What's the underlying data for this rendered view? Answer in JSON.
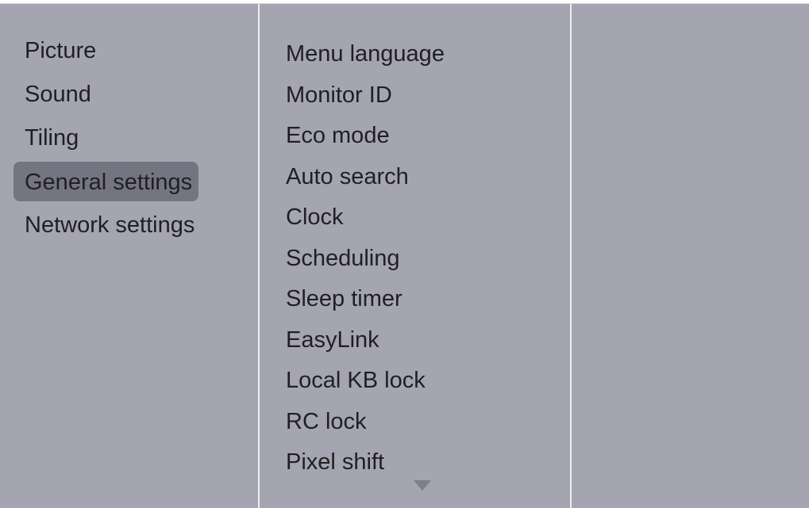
{
  "main_menu": {
    "items": [
      {
        "label": "Picture"
      },
      {
        "label": "Sound"
      },
      {
        "label": "Tiling"
      },
      {
        "label": "General settings",
        "selected": true
      },
      {
        "label": "Network settings"
      }
    ]
  },
  "submenu": {
    "items": [
      {
        "label": "Menu language"
      },
      {
        "label": "Monitor ID"
      },
      {
        "label": "Eco mode"
      },
      {
        "label": "Auto search"
      },
      {
        "label": "Clock"
      },
      {
        "label": "Scheduling"
      },
      {
        "label": "Sleep timer"
      },
      {
        "label": "EasyLink"
      },
      {
        "label": "Local KB lock"
      },
      {
        "label": "RC lock"
      },
      {
        "label": "Pixel shift"
      }
    ],
    "more_indicator": "chevron-down-icon"
  },
  "colors": {
    "panel_background": "#a4a5b0",
    "selected_highlight": "#747581",
    "divider": "#eeeff2",
    "text": "#1f1f24"
  }
}
